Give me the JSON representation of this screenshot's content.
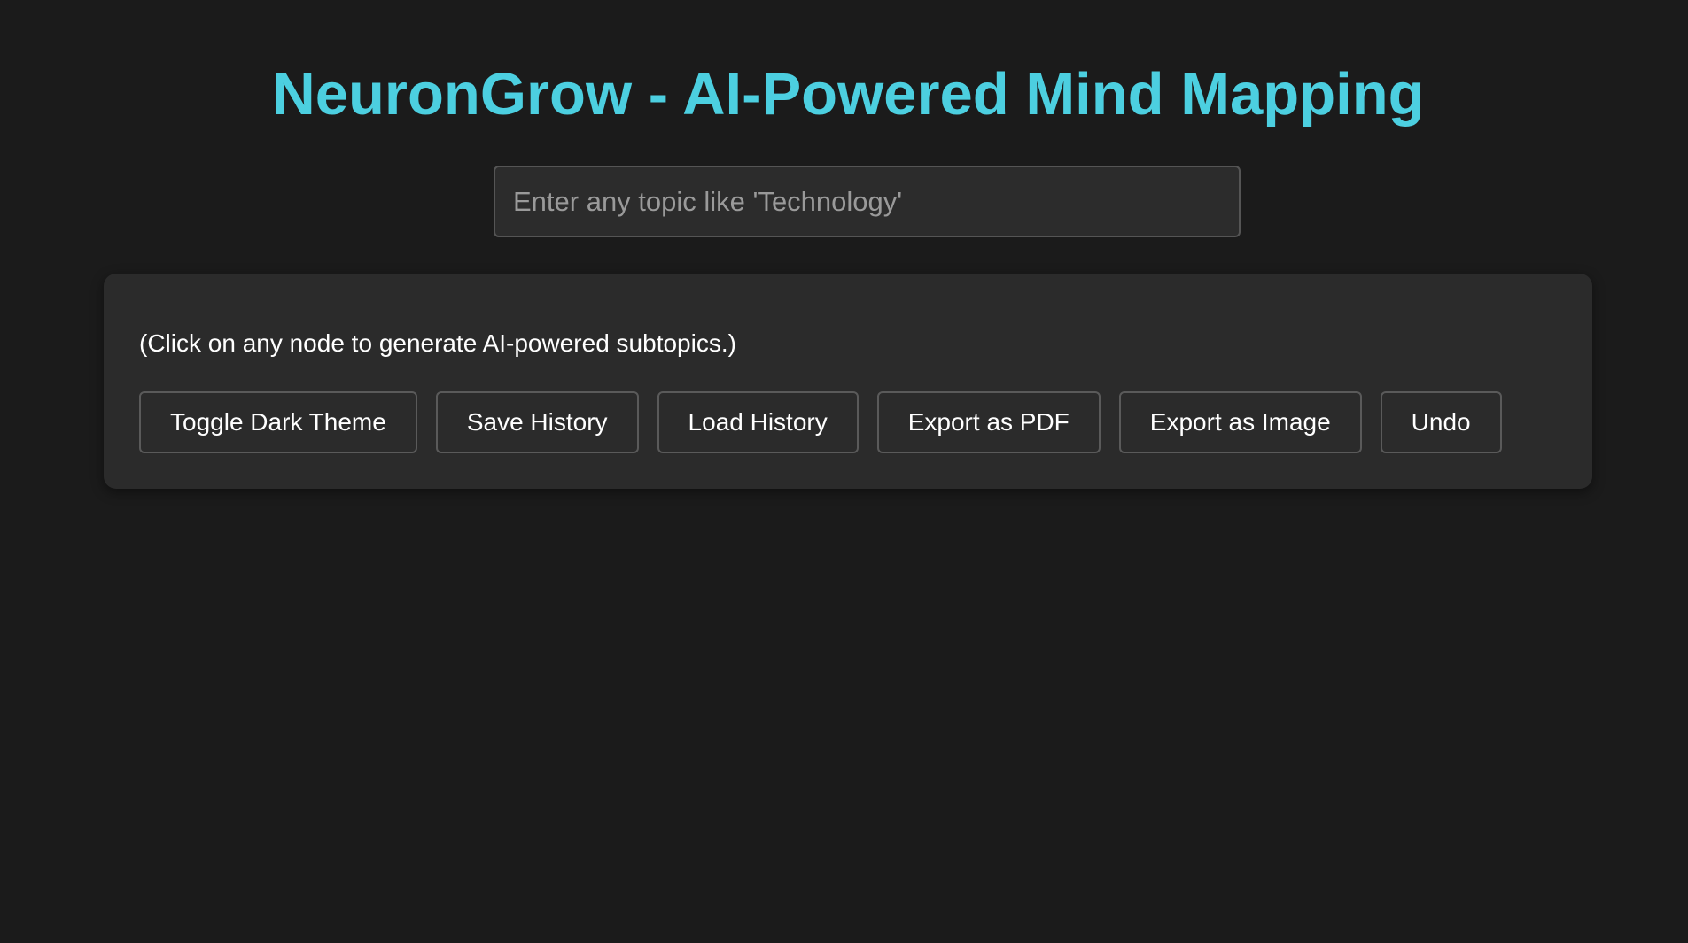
{
  "app": {
    "title": "NeuronGrow - AI-Powered Mind Mapping"
  },
  "search": {
    "value": "",
    "placeholder": "Enter any topic like 'Technology'"
  },
  "panel": {
    "hint": "(Click on any node to generate AI-powered subtopics.)",
    "buttons": {
      "toggle_theme": "Toggle Dark Theme",
      "save_history": "Save History",
      "load_history": "Load History",
      "export_pdf": "Export as PDF",
      "export_image": "Export as Image",
      "undo": "Undo"
    }
  },
  "colors": {
    "background": "#1b1b1b",
    "accent": "#4ccfe0",
    "panel": "#2b2b2b"
  }
}
